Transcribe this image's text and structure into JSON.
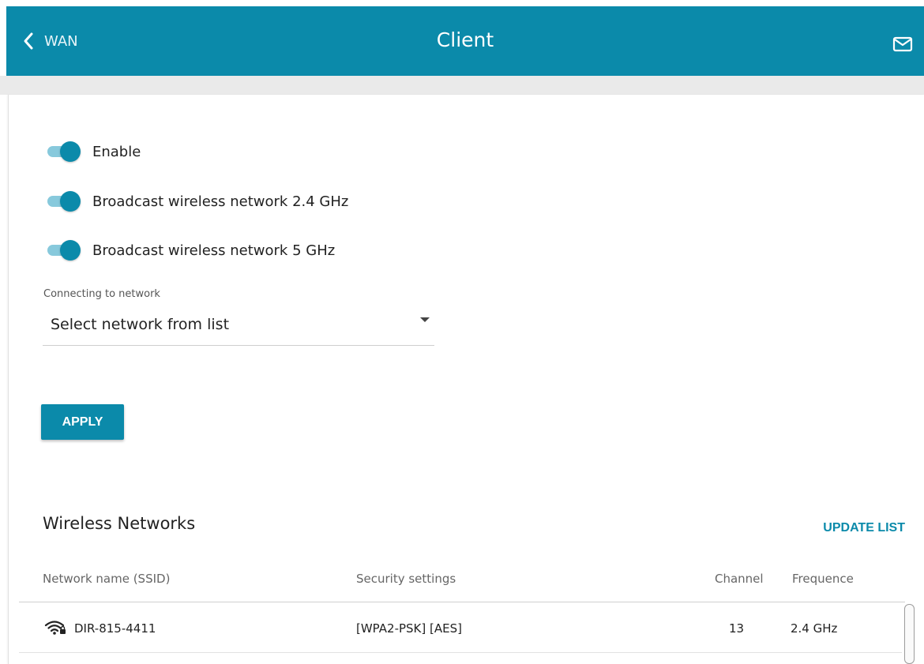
{
  "header": {
    "back_label": "WAN",
    "title": "Client",
    "back_icon": "chevron-left-icon",
    "mail_icon": "envelope-icon"
  },
  "toggles": [
    {
      "label": "Enable",
      "on": true
    },
    {
      "label": "Broadcast wireless network 2.4 GHz",
      "on": true
    },
    {
      "label": "Broadcast wireless network 5 GHz",
      "on": true
    }
  ],
  "connect": {
    "label": "Connecting to network",
    "value": "Select network from list"
  },
  "apply_label": "APPLY",
  "wireless": {
    "title": "Wireless Networks",
    "update_label": "UPDATE LIST",
    "columns": [
      "Network name (SSID)",
      "Security settings",
      "Channel",
      "Frequence"
    ],
    "rows": [
      {
        "ssid": "DIR-815-4411",
        "security": "[WPA2-PSK] [AES]",
        "channel": "13",
        "frequency": "2.4 GHz",
        "icon": "wifi-lock-icon"
      }
    ]
  },
  "colors": {
    "accent": "#0b8aaa",
    "toggle_track": "#87c9dc",
    "background_band": "#eaeaea"
  }
}
